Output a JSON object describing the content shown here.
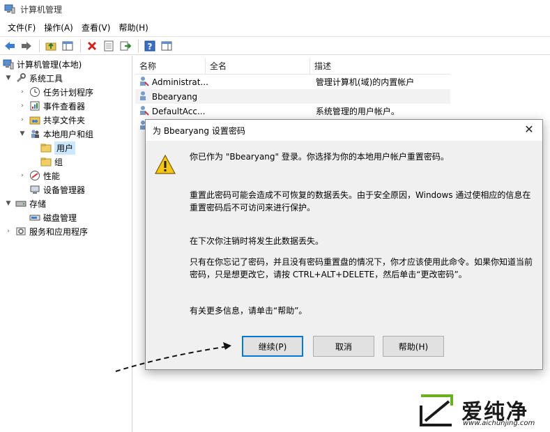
{
  "window": {
    "title": "计算机管理"
  },
  "menu": [
    "文件(F)",
    "操作(A)",
    "查看(V)",
    "帮助(H)"
  ],
  "toolbar": [
    "back-icon",
    "forward-icon",
    "up-folder-icon",
    "show-tree-icon",
    "delete-icon",
    "properties-icon",
    "export-icon",
    "help-icon",
    "action-pane-icon"
  ],
  "tree": {
    "root": "计算机管理(本地)",
    "system_tools": "系统工具",
    "task_scheduler": "任务计划程序",
    "event_viewer": "事件查看器",
    "shared_folders": "共享文件夹",
    "local_users": "本地用户和组",
    "users": "用户",
    "groups": "组",
    "performance": "性能",
    "device_manager": "设备管理器",
    "storage": "存储",
    "disk_management": "磁盘管理",
    "services_apps": "服务和应用程序"
  },
  "list": {
    "columns": [
      "名称",
      "全名",
      "描述"
    ],
    "rows": [
      {
        "name": "Administrat...",
        "fullname": "",
        "description": "管理计算机(域)的内置帐户"
      },
      {
        "name": "Bbearyang",
        "fullname": "",
        "description": ""
      },
      {
        "name": "DefaultAcc...",
        "fullname": "",
        "description": "系统管理的用户帐户。"
      }
    ]
  },
  "dialog": {
    "title": "为 Bbearyang 设置密码",
    "close": "✕",
    "p1": "你已作为 \"Bbearyang\" 登录。你选择为你的本地用户帐户重置密码。",
    "p2": "重置此密码可能会造成不可恢复的数据丢失。由于安全原因，Windows 通过使相应的信息在重置密码后不可访问来进行保护。",
    "p3": "在下次你注销时将发生此数据丢失。",
    "p4": "只有在你忘记了密码，并且没有密码重置盘的情况下，你才应该使用此命令。如果你知道当前密码，只是想更改它，请按 CTRL+ALT+DELETE，然后单击“更改密码”。",
    "p5": "有关更多信息，请单击“帮助”。",
    "buttons": {
      "continue": "继续(P)",
      "cancel": "取消",
      "help": "帮助(H)"
    }
  },
  "watermark": {
    "brand": "爱纯净",
    "url": "www.aichunjing.com"
  }
}
